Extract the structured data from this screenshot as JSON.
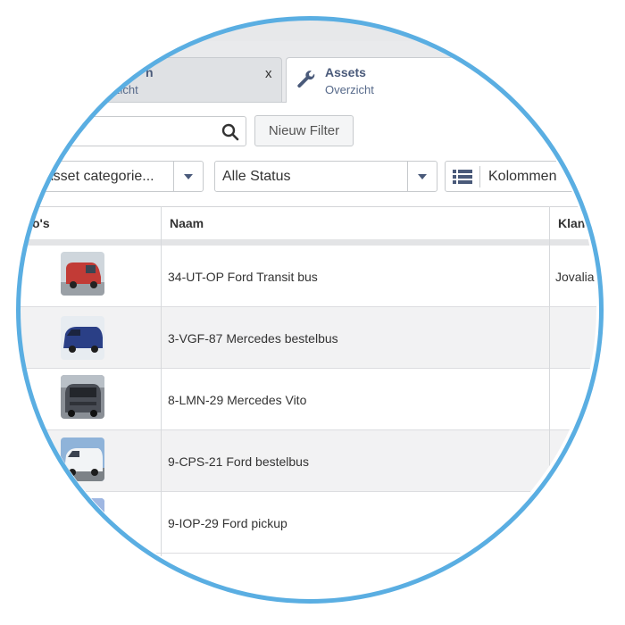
{
  "tabs": [
    {
      "title": "n",
      "subtitle": "zicht",
      "close": "x"
    },
    {
      "title": "Assets",
      "subtitle": "Overzicht"
    }
  ],
  "toolbar": {
    "search_value": "",
    "new_filter_label": "Nieuw Filter",
    "category_select": "Asset categorie...",
    "status_select": "Alle Status",
    "columns_label": "Kolommen"
  },
  "table": {
    "headers": [
      "o's",
      "Naam",
      "Klant"
    ],
    "rows": [
      {
        "name": "34-UT-OP Ford Transit bus",
        "klant": "Jovalia",
        "photo": "red-van-photo",
        "color": "#c23b36"
      },
      {
        "name": "3-VGF-87 Mercedes bestelbus",
        "klant": "",
        "photo": "blue-van-photo",
        "color": "#2a3f86"
      },
      {
        "name": "8-LMN-29 Mercedes Vito",
        "klant": "",
        "photo": "grey-van-photo",
        "color": "#5a5e66"
      },
      {
        "name": "9-CPS-21 Ford bestelbus",
        "klant": "",
        "photo": "white-van-photo",
        "color": "#e8ecef"
      },
      {
        "name": "9-IOP-29 Ford pickup",
        "klant": "",
        "photo": "blue-pickup-photo",
        "color": "#6e8fcf"
      }
    ]
  },
  "colors": {
    "accent": "#5aaee2",
    "tab_text": "#4a5a7a"
  }
}
